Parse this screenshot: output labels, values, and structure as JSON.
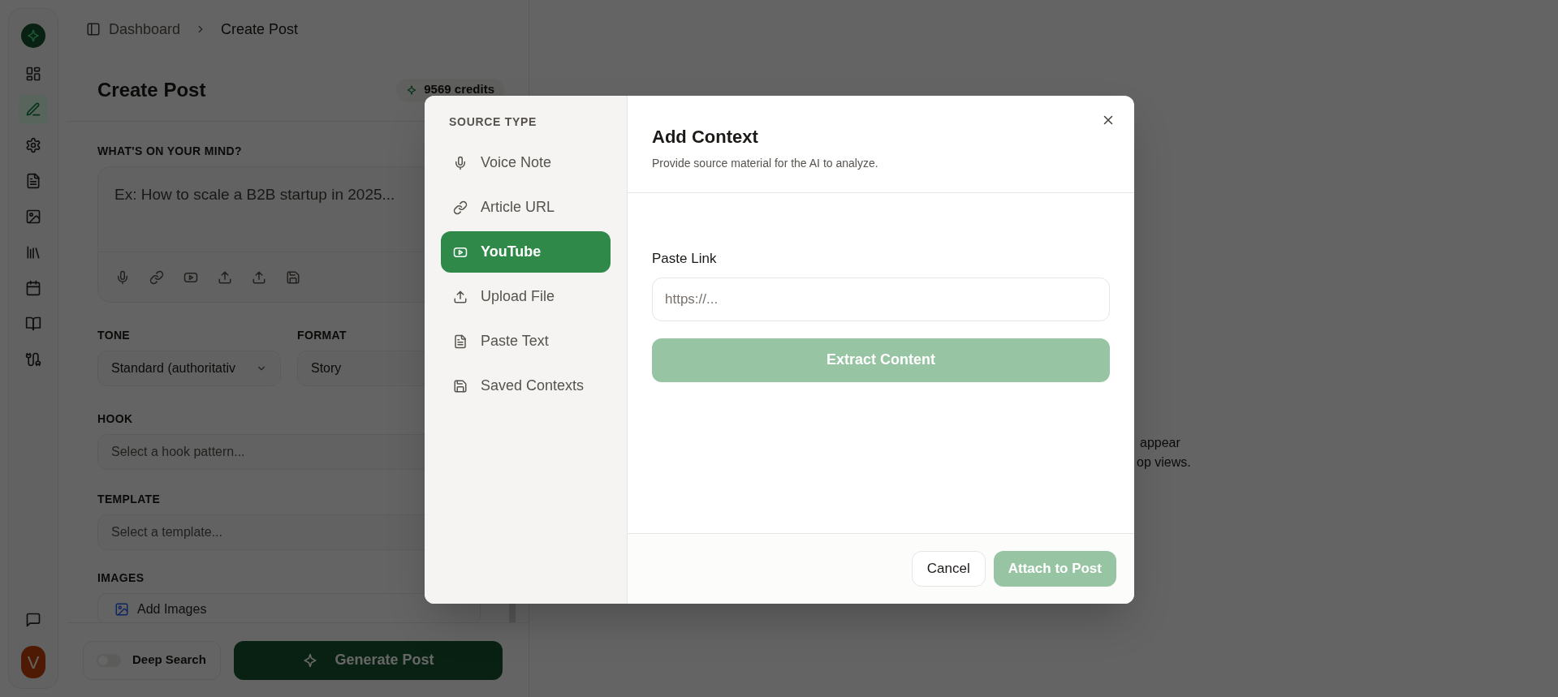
{
  "sidebar": {
    "items": [
      {
        "selected": false
      },
      {
        "selected": true
      },
      {
        "selected": false
      },
      {
        "selected": false
      },
      {
        "selected": false
      },
      {
        "selected": false
      },
      {
        "selected": false
      },
      {
        "selected": false
      },
      {
        "selected": false
      }
    ],
    "avatar": "V"
  },
  "breadcrumb": [
    "Dashboard",
    "Create Post"
  ],
  "panel": {
    "title": "Create Post",
    "credits": "9569 credits",
    "prompt": {
      "label": "WHAT'S ON YOUR MIND?",
      "placeholder": "Ex: How to scale a B2B startup in 2025..."
    },
    "tone": {
      "label": "TONE",
      "value": "Standard (authoritativ"
    },
    "format": {
      "label": "FORMAT",
      "value": "Story"
    },
    "hook": {
      "label": "HOOK",
      "placeholder": "Select a hook pattern..."
    },
    "template": {
      "label": "TEMPLATE",
      "placeholder": "Select a template..."
    },
    "images": {
      "label": "IMAGES",
      "button": "Add Images"
    },
    "deep_search": {
      "label": "Deep Search",
      "on": false
    },
    "generate": "Generate Post"
  },
  "preview_text": [
    "appear",
    "op views."
  ],
  "modal": {
    "sidebar_title": "SOURCE TYPE",
    "sources": [
      {
        "label": "Voice Note",
        "selected": false
      },
      {
        "label": "Article URL",
        "selected": false
      },
      {
        "label": "YouTube",
        "selected": true
      },
      {
        "label": "Upload File",
        "selected": false
      },
      {
        "label": "Paste Text",
        "selected": false
      },
      {
        "label": "Saved Contexts",
        "selected": false
      }
    ],
    "title": "Add Context",
    "subtitle": "Provide source material for the AI to analyze.",
    "field_label": "Paste Link",
    "placeholder": "https://...",
    "extract": "Extract Content",
    "buttons": {
      "cancel": "Cancel",
      "attach": "Attach to Post"
    }
  }
}
